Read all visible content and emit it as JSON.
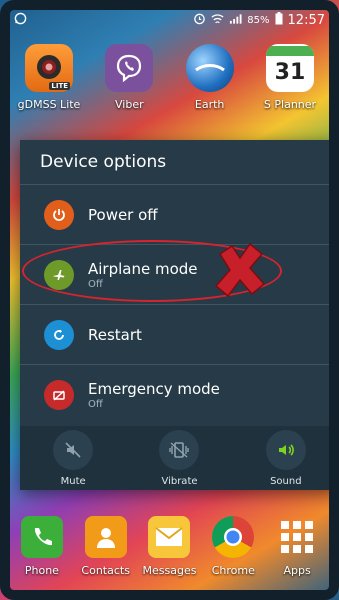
{
  "status_bar": {
    "battery": "85%",
    "time": "12:57"
  },
  "apps_top": [
    {
      "label": "gDMSS Lite",
      "badge": "LITE"
    },
    {
      "label": "Viber"
    },
    {
      "label": "Earth"
    },
    {
      "label": "S Planner",
      "date_number": "31"
    }
  ],
  "dialog": {
    "title": "Device options",
    "options": [
      {
        "label": "Power off"
      },
      {
        "label": "Airplane mode",
        "sublabel": "Off"
      },
      {
        "label": "Restart"
      },
      {
        "label": "Emergency mode",
        "sublabel": "Off"
      }
    ],
    "quick_actions": [
      {
        "label": "Mute"
      },
      {
        "label": "Vibrate"
      },
      {
        "label": "Sound",
        "active": true
      }
    ]
  },
  "dock": [
    {
      "label": "Phone"
    },
    {
      "label": "Contacts"
    },
    {
      "label": "Messages"
    },
    {
      "label": "Chrome"
    },
    {
      "label": "Apps"
    }
  ],
  "colors": {
    "dialog_bg": "#263b47",
    "power_off": "#e25e1b",
    "airplane": "#6e9a2a",
    "restart": "#1d8fd4",
    "emergency": "#c62a2a",
    "annotation_red": "#d9232e"
  }
}
